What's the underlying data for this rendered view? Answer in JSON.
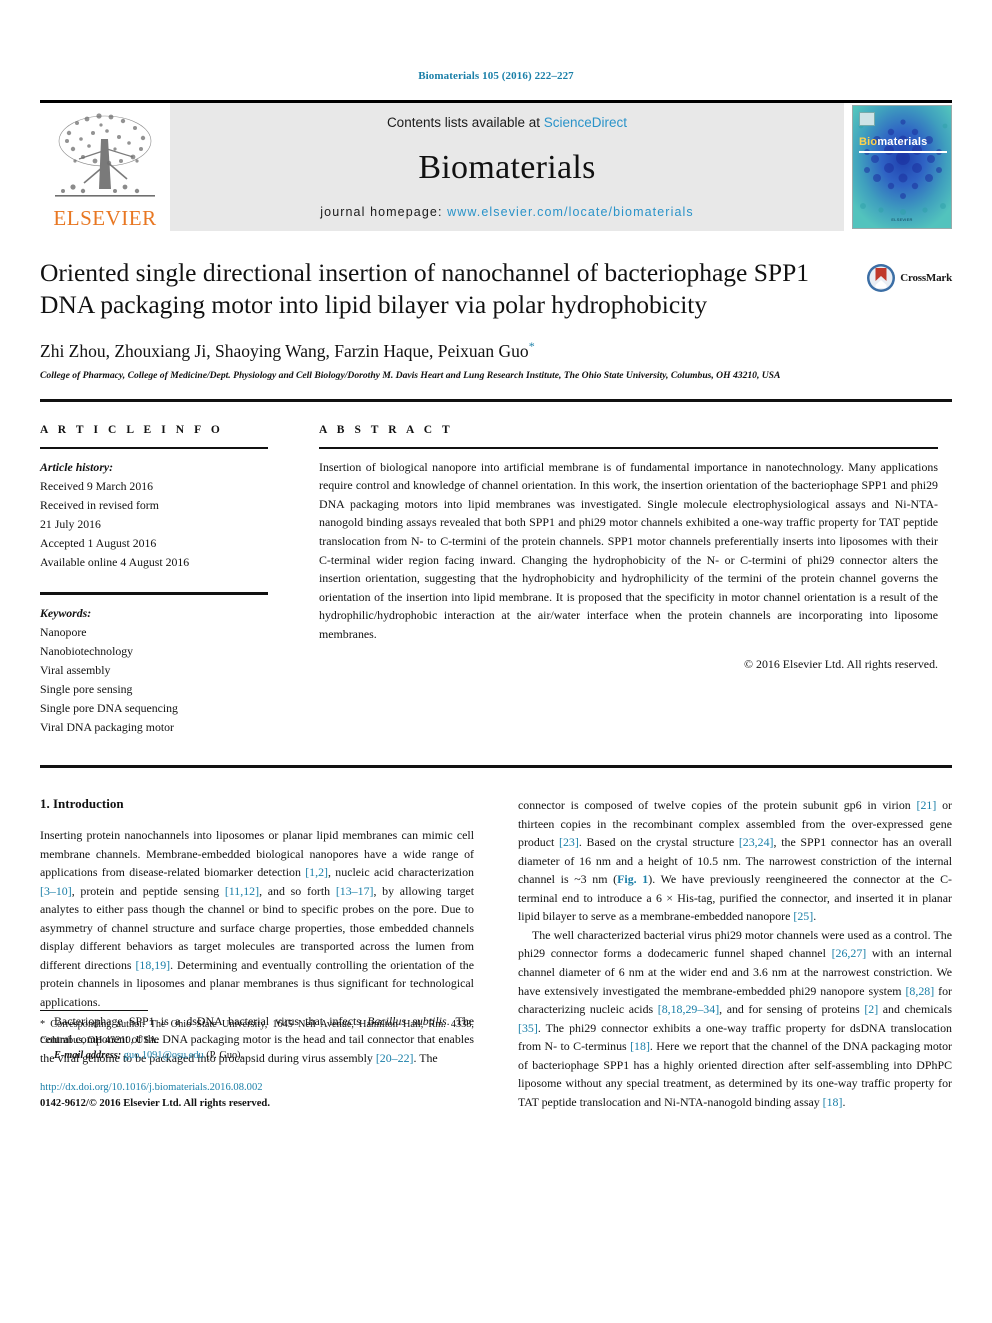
{
  "colors": {
    "link": "#1a7fa8",
    "sciencedirect": "#2a93c9",
    "elsevier_orange": "#E87722",
    "masthead_bg": "#e8e8e8",
    "cover_teal": "#35a8ab"
  },
  "running_head": "Biomaterials 105 (2016) 222–227",
  "masthead": {
    "publisher_name": "ELSEVIER",
    "contents_prefix": "Contents lists available at ",
    "contents_link": "ScienceDirect",
    "journal_title": "Biomaterials",
    "homepage_prefix": "journal homepage: ",
    "homepage_url": "www.elsevier.com/locate/biomaterials",
    "cover": {
      "title_first": "Bio",
      "title_rest": "materials",
      "footer": "ELSEVIER"
    }
  },
  "article": {
    "title": "Oriented single directional insertion of nanochannel of bacteriophage SPP1 DNA packaging motor into lipid bilayer via polar hydrophobicity",
    "crossmark_label": "CrossMark",
    "authors": "Zhi Zhou, Zhouxiang Ji, Shaoying Wang, Farzin Haque, Peixuan Guo",
    "corresponding_marker": "*",
    "affiliation": "College of Pharmacy, College of Medicine/Dept. Physiology and Cell Biology/Dorothy M. Davis Heart and Lung Research Institute, The Ohio State University, Columbus, OH 43210, USA"
  },
  "article_info": {
    "heading": "A R T I C L E   I N F O",
    "history_label": "Article history:",
    "history": [
      "Received 9 March 2016",
      "Received in revised form",
      "21 July 2016",
      "Accepted 1 August 2016",
      "Available online 4 August 2016"
    ],
    "keywords_label": "Keywords:",
    "keywords": [
      "Nanopore",
      "Nanobiotechnology",
      "Viral assembly",
      "Single pore sensing",
      "Single pore DNA sequencing",
      "Viral DNA packaging motor"
    ]
  },
  "abstract": {
    "heading": "A B S T R A C T",
    "text": "Insertion of biological nanopore into artificial membrane is of fundamental importance in nanotechnology. Many applications require control and knowledge of channel orientation. In this work, the insertion orientation of the bacteriophage SPP1 and phi29 DNA packaging motors into lipid membranes was investigated. Single molecule electrophysiological assays and Ni-NTA-nanogold binding assays revealed that both SPP1 and phi29 motor channels exhibited a one-way traffic property for TAT peptide translocation from N- to C-termini of the protein channels. SPP1 motor channels preferentially inserts into liposomes with their C-terminal wider region facing inward. Changing the hydrophobicity of the N- or C-termini of phi29 connector alters the insertion orientation, suggesting that the hydrophobicity and hydrophilicity of the termini of the protein channel governs the orientation of the insertion into lipid membrane. It is proposed that the specificity in motor channel orientation is a result of the hydrophilic/hydrophobic interaction at the air/water interface when the protein channels are incorporating into liposome membranes.",
    "copyright": "© 2016 Elsevier Ltd. All rights reserved."
  },
  "introduction": {
    "heading": "1. Introduction",
    "left_paragraphs": [
      "Inserting protein nanochannels into liposomes or planar lipid membranes can mimic cell membrane channels. Membrane-embedded biological nanopores have a wide range of applications from disease-related biomarker detection [1,2], nucleic acid characterization [3–10], protein and peptide sensing [11,12], and so forth [13–17], by allowing target analytes to either pass though the channel or bind to specific probes on the pore. Due to asymmetry of channel structure and surface charge properties, those embedded channels display different behaviors as target molecules are transported across the lumen from different directions [18,19]. Determining and eventually controlling the orientation of the protein channels in liposomes and planar membranes is thus significant for technological applications.",
      "Bacteriophage SPP1 is a dsDNA bacterial virus that infects Bacillus subtilis. The central component of the DNA packaging motor is the head and tail connector that enables the viral genome to be packaged into procapsid during virus assembly [20–22]. The"
    ],
    "right_paragraphs": [
      "connector is composed of twelve copies of the protein subunit gp6 in virion [21] or thirteen copies in the recombinant complex assembled from the over-expressed gene product [23]. Based on the crystal structure [23,24], the SPP1 connector has an overall diameter of 16 nm and a height of 10.5 nm. The narrowest constriction of the internal channel is ~3 nm (Fig. 1). We have previously reengineered the connector at the C-terminal end to introduce a 6 × His-tag, purified the connector, and inserted it in planar lipid bilayer to serve as a membrane-embedded nanopore [25].",
      "The well characterized bacterial virus phi29 motor channels were used as a control. The phi29 connector forms a dodecameric funnel shaped channel [26,27] with an internal channel diameter of 6 nm at the wider end and 3.6 nm at the narrowest constriction. We have extensively investigated the membrane-embedded phi29 nanopore system [8,28] for characterizing nucleic acids [8,18,29–34], and for sensing of proteins [2] and chemicals [35]. The phi29 connector exhibits a one-way traffic property for dsDNA translocation from N- to C-terminus [18]. Here we report that the channel of the DNA packaging motor of bacteriophage SPP1 has a highly oriented direction after self-assembling into DPhPC liposome without any special treatment, as determined by its one-way traffic property for TAT peptide translocation and Ni-NTA-nanogold binding assay [18]."
    ]
  },
  "footnote": {
    "corresponding": "* Corresponding author. The Ohio State University, 1645 Neil Avenue, Hamilton Hall, Rm. 4338, Columbus, OH 43210, USA.",
    "email_label": "E-mail address:",
    "email": "guo.1091@osu.edu",
    "email_suffix": "(P. Guo).",
    "doi": "http://dx.doi.org/10.1016/j.biomaterials.2016.08.002",
    "issn_line": "0142-9612/© 2016 Elsevier Ltd. All rights reserved."
  }
}
